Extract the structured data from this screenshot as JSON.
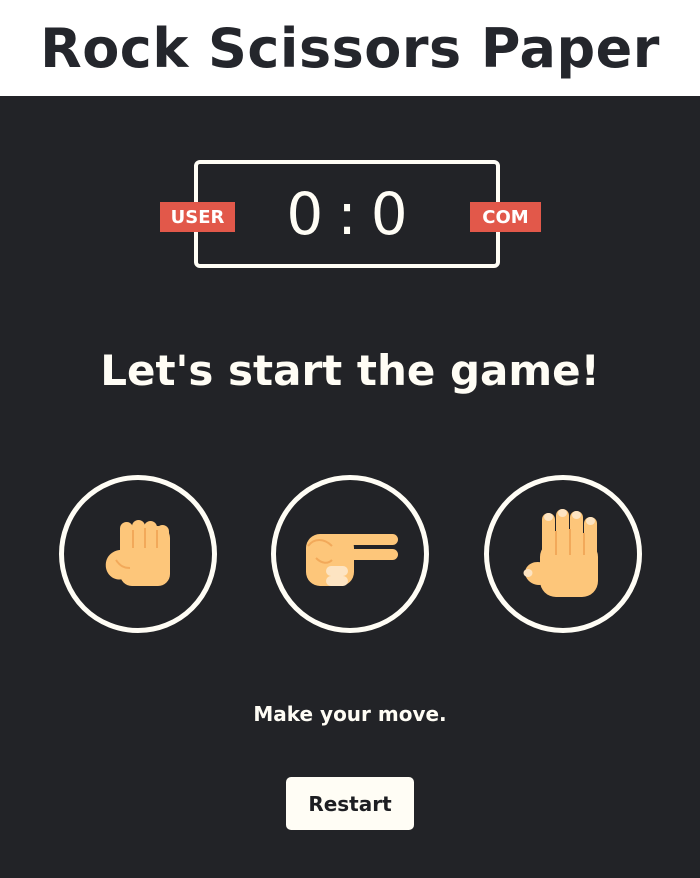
{
  "page": {
    "title": "Rock Scissors Paper"
  },
  "scoreboard": {
    "user_label": "USER",
    "com_label": "COM",
    "user_score": "0",
    "separator": ":",
    "com_score": "0"
  },
  "message": "Let's start the game!",
  "choices": [
    {
      "name": "rock",
      "icon": "rock-hand-icon"
    },
    {
      "name": "scissors",
      "icon": "scissors-hand-icon"
    },
    {
      "name": "paper",
      "icon": "paper-hand-icon"
    }
  ],
  "prompt": "Make your move.",
  "restart_label": "Restart",
  "colors": {
    "background": "#222327",
    "foreground": "#fffdf5",
    "badge": "#e2584a",
    "skin": "#fdc67a",
    "skin_shadow": "#f2a95a",
    "nail": "#fde4c2"
  }
}
